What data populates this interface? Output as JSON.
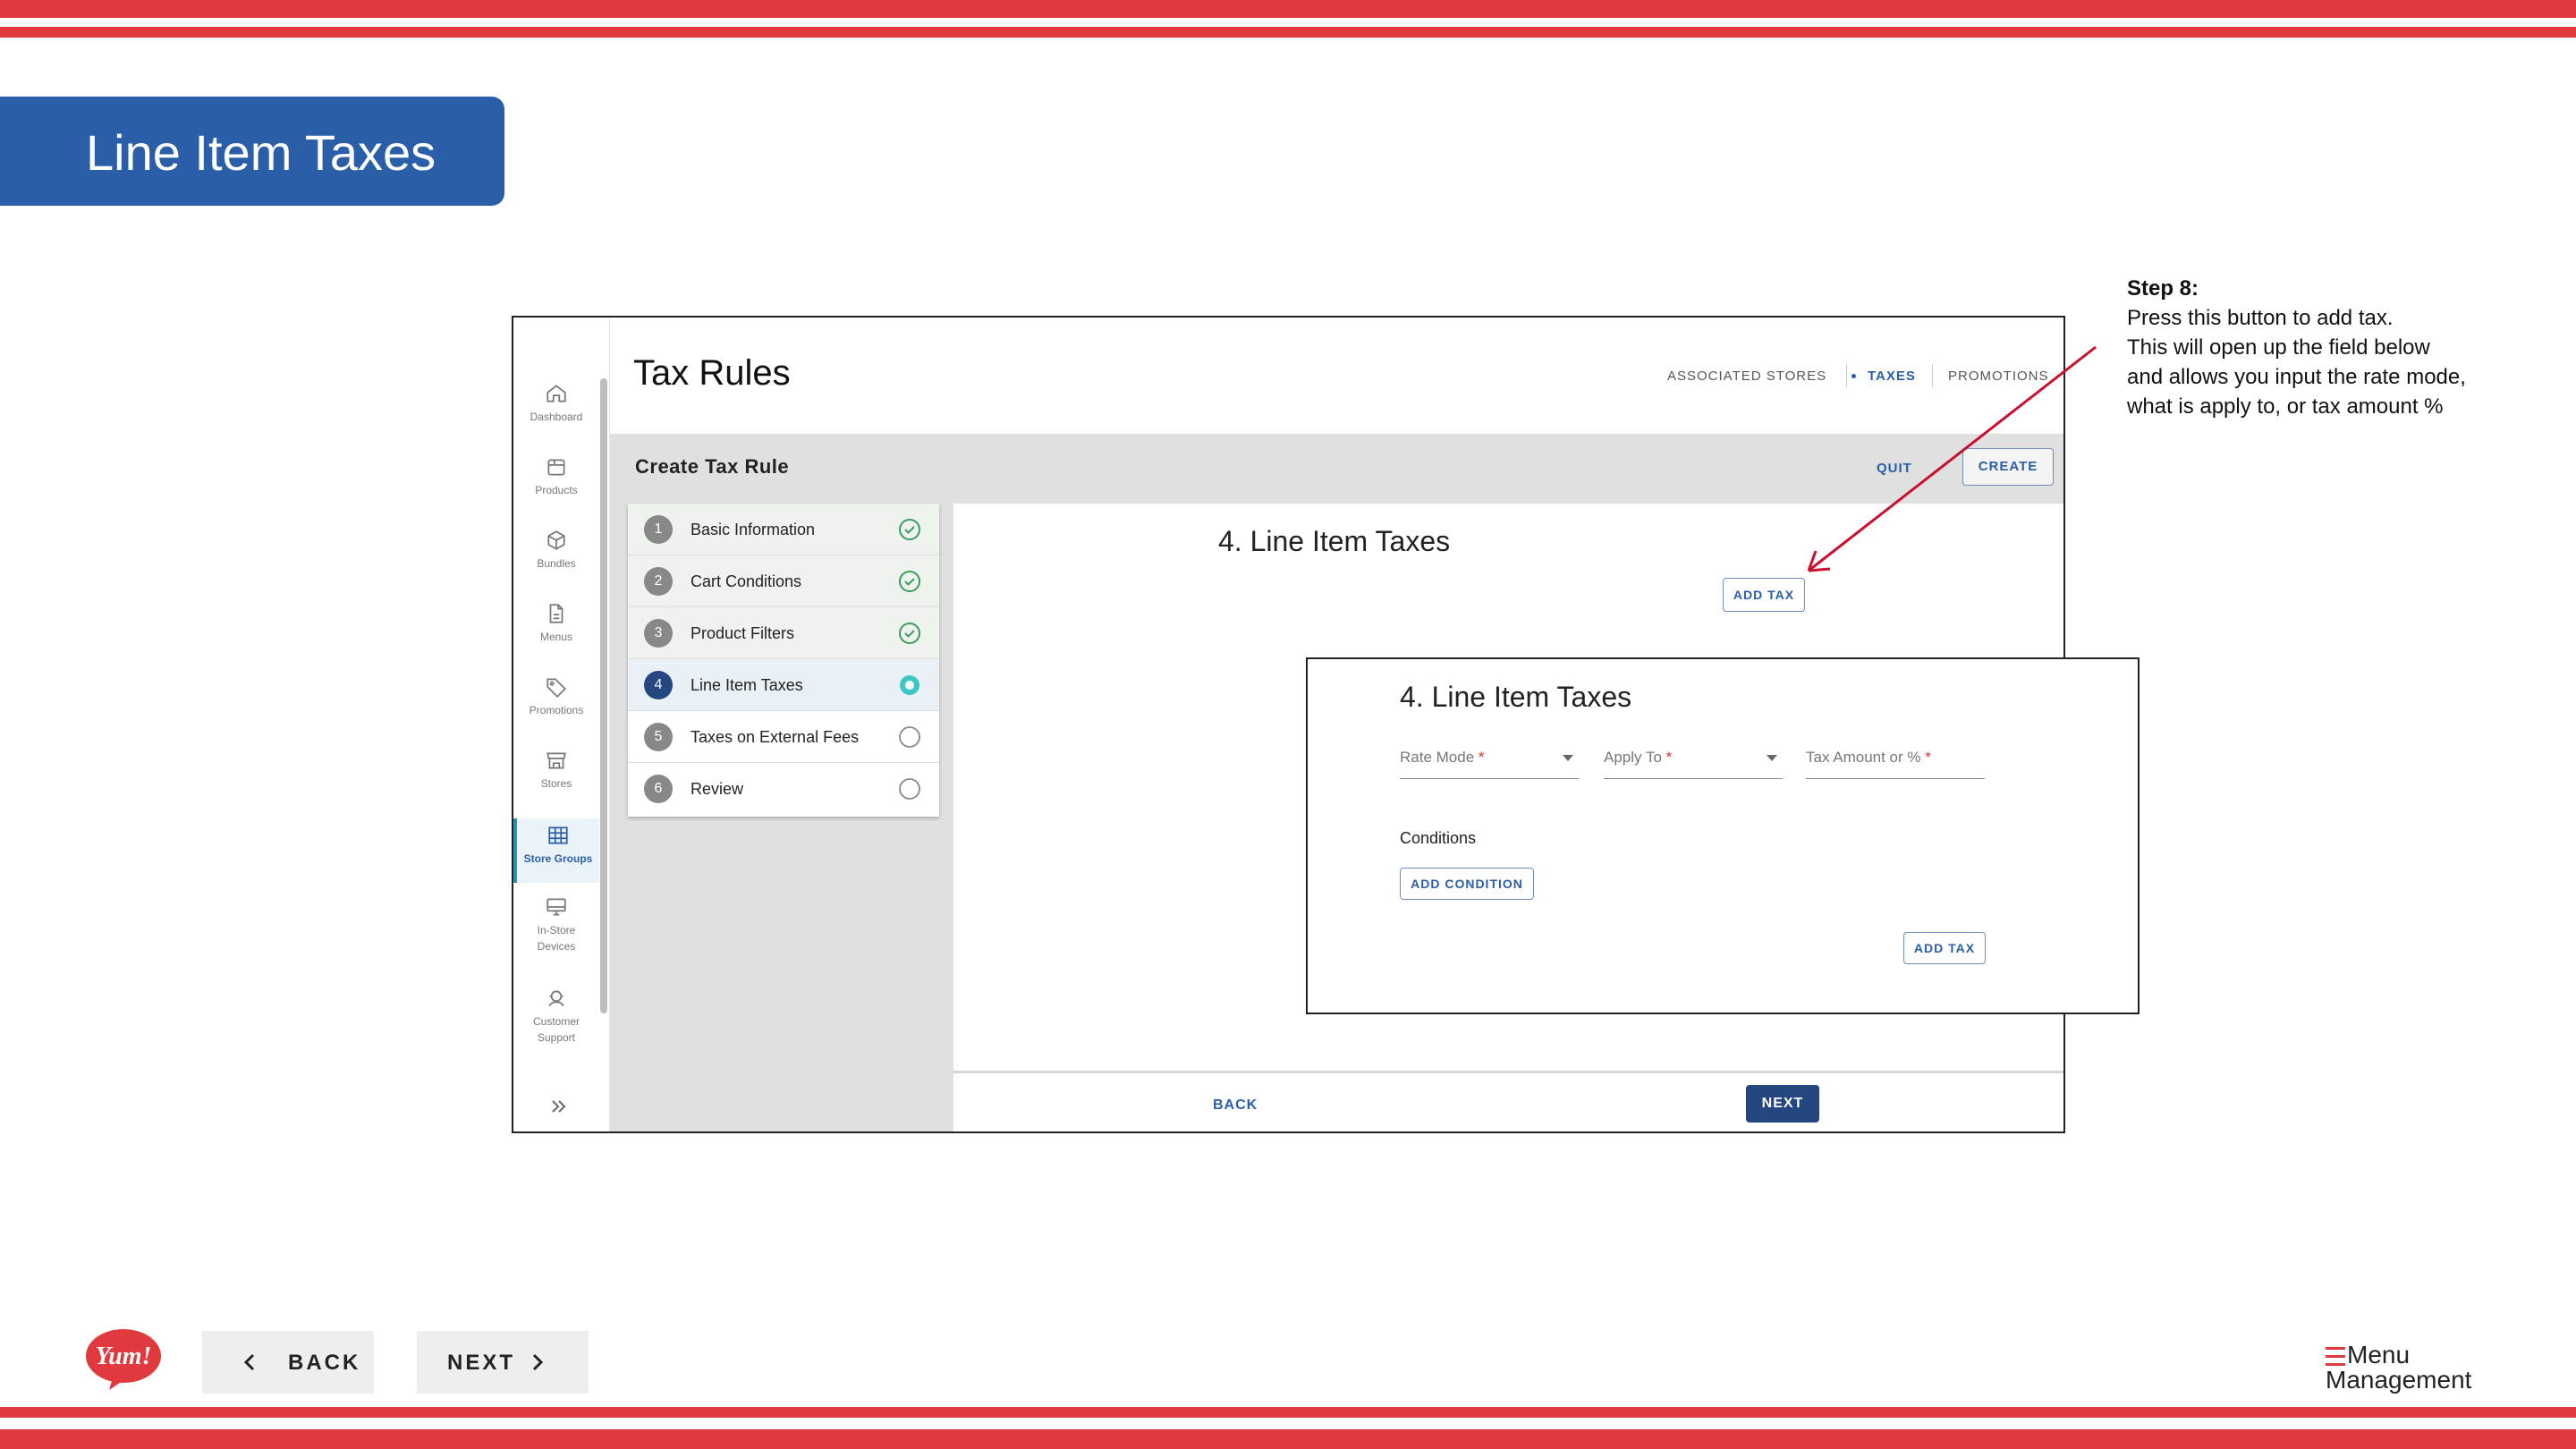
{
  "slide": {
    "title": "Line Item Taxes",
    "back_label": "BACK",
    "next_label": "NEXT",
    "brand_logo_text": "Yum!",
    "product_logo_line1": "Menu",
    "product_logo_line2": "Management"
  },
  "annotation": {
    "step": "Step 8:",
    "line1": "Press this button to add tax.",
    "line2": "This will open up the field below",
    "line3": "and allows you input the rate mode,",
    "line4": "what is apply to, or tax amount %"
  },
  "app": {
    "page_title": "Tax Rules",
    "top_tabs": {
      "associated_stores": "ASSOCIATED STORES",
      "taxes": "TAXES",
      "promotions": "PROMOTIONS"
    },
    "sidebar": {
      "items": [
        {
          "label": "Dashboard",
          "icon": "home-icon"
        },
        {
          "label": "Products",
          "icon": "box-icon"
        },
        {
          "label": "Bundles",
          "icon": "cube-icon"
        },
        {
          "label": "Menus",
          "icon": "document-icon"
        },
        {
          "label": "Promotions",
          "icon": "tag-icon"
        },
        {
          "label": "Stores",
          "icon": "storefront-icon"
        },
        {
          "label": "Store Groups",
          "icon": "grid-icon",
          "active": true
        },
        {
          "label": "In-Store",
          "label2": "Devices",
          "icon": "monitor-icon"
        },
        {
          "label": "Customer",
          "label2": "Support",
          "icon": "headset-icon"
        }
      ]
    },
    "toolbar": {
      "title": "Create Tax Rule",
      "quit_label": "QUIT",
      "create_label": "CREATE"
    },
    "steps": [
      {
        "num": "1",
        "label": "Basic Information",
        "status": "complete"
      },
      {
        "num": "2",
        "label": "Cart Conditions",
        "status": "complete"
      },
      {
        "num": "3",
        "label": "Product Filters",
        "status": "complete"
      },
      {
        "num": "4",
        "label": "Line Item Taxes",
        "status": "current"
      },
      {
        "num": "5",
        "label": "Taxes on External Fees",
        "status": "pending"
      },
      {
        "num": "6",
        "label": "Review",
        "status": "pending"
      }
    ],
    "section_title": "4. Line Item Taxes",
    "add_tax_label": "ADD TAX",
    "back_label": "BACK",
    "next_label": "NEXT"
  },
  "inset": {
    "section_title": "4. Line Item Taxes",
    "rate_mode_label": "Rate Mode",
    "apply_to_label": "Apply To",
    "tax_amount_label": "Tax Amount or %",
    "required_mark": "*",
    "conditions_label": "Conditions",
    "add_condition_label": "ADD CONDITION",
    "add_tax_label": "ADD TAX"
  },
  "colors": {
    "stripe": "#e0393e",
    "title_tab": "#2a5ea8",
    "primary": "#24477f",
    "accent_link": "#2a5ea8",
    "arrow": "#c8102e",
    "complete_check": "#3c9a5f",
    "current_dot": "#3cc6c6"
  }
}
